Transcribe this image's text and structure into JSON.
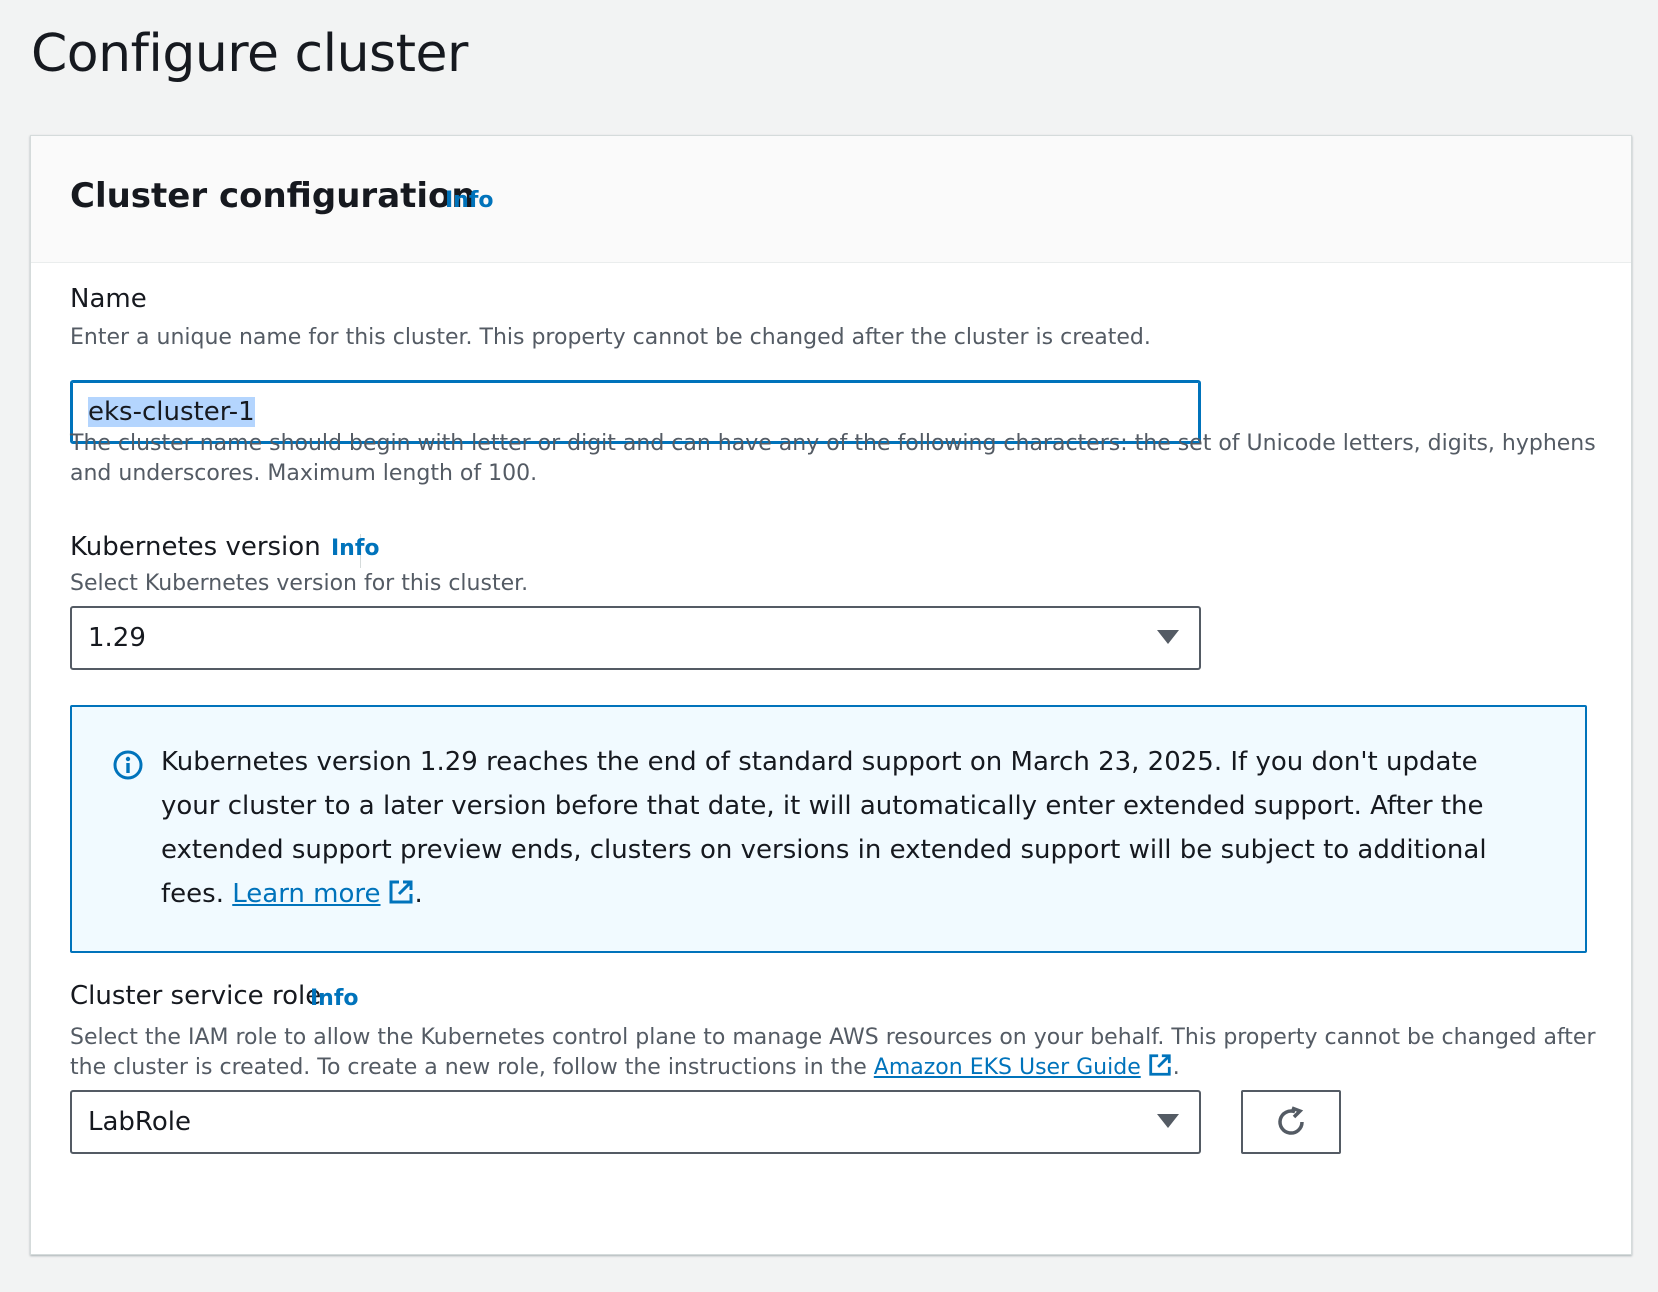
{
  "page": {
    "title": "Configure cluster"
  },
  "panel": {
    "title": "Cluster configuration",
    "info": "Info"
  },
  "name_field": {
    "label": "Name",
    "description": "Enter a unique name for this cluster. This property cannot be changed after the cluster is created.",
    "value": "eks-cluster-1",
    "hint_line1": "The cluster name should begin with letter or digit and can have any of the following characters: the set of Unicode letters, digits, hyphens",
    "hint_line2": "and underscores. Maximum length of 100."
  },
  "k8s_version": {
    "label": "Kubernetes version",
    "info": "Info",
    "description": "Select Kubernetes version for this cluster.",
    "selected": "1.29"
  },
  "alert": {
    "text": "Kubernetes version 1.29 reaches the end of standard support on March 23, 2025. If you don't update your cluster to a later version before that date, it will automatically enter extended support. After the extended support preview ends, clusters on versions in extended support will be subject to additional fees.",
    "link": "Learn more",
    "suffix": ".",
    "icon": "info-circle-icon"
  },
  "service_role": {
    "label": "Cluster service role",
    "info": "Info",
    "description_line1": "Select the IAM role to allow the Kubernetes control plane to manage AWS resources on your behalf. This property cannot be changed after",
    "description_line2_prefix": "the cluster is created. To create a new role, follow the instructions in the",
    "guide_link": "Amazon EKS User Guide",
    "suffix": ".",
    "selected": "LabRole",
    "refresh_icon": "refresh-icon"
  },
  "colors": {
    "accent": "#0073bb",
    "alert_bg": "#f1faff",
    "page_bg": "#f2f3f3"
  }
}
